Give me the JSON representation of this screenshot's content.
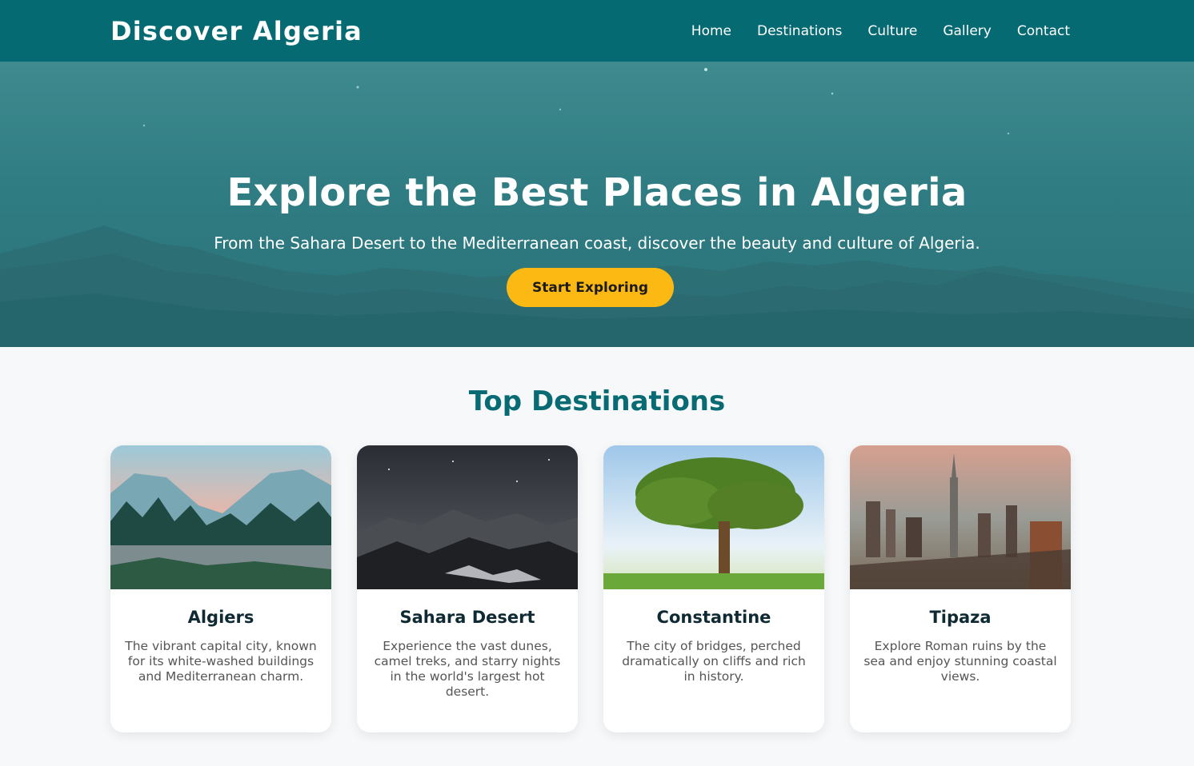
{
  "header": {
    "logo": "Discover Algeria",
    "nav": [
      "Home",
      "Destinations",
      "Culture",
      "Gallery",
      "Contact"
    ]
  },
  "hero": {
    "title": "Explore the Best Places in Algeria",
    "subtitle": "From the Sahara Desert to the Mediterranean coast, discover the beauty and culture of Algeria.",
    "cta_label": "Start Exploring"
  },
  "destinations": {
    "title": "Top Destinations",
    "cards": [
      {
        "title": "Algiers",
        "description": "The vibrant capital city, known for its white-washed buildings and Mediterranean charm."
      },
      {
        "title": "Sahara Desert",
        "description": "Experience the vast dunes, camel treks, and starry nights in the world's largest hot desert."
      },
      {
        "title": "Constantine",
        "description": "The city of bridges, perched dramatically on cliffs and rich in history."
      },
      {
        "title": "Tipaza",
        "description": "Explore Roman ruins by the sea and enjoy stunning coastal views."
      }
    ]
  },
  "colors": {
    "header_bg": "#066a73",
    "accent": "#fdb913",
    "section_title": "#086a72"
  }
}
